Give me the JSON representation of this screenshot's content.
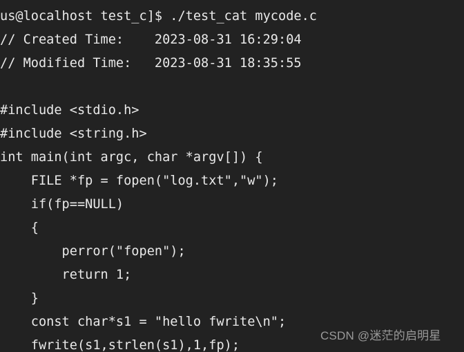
{
  "terminal": {
    "background_color": "#222222",
    "text_color": "#e9e9e9",
    "prompt_line": "us@localhost test_c]$ ./test_cat mycode.c",
    "lines": [
      {
        "text": "us@localhost test_c]$ ./test_cat mycode.c"
      },
      {
        "text": "// Created Time:    2023-08-31 16:29:04"
      },
      {
        "text": "// Modified Time:   2023-08-31 18:35:55"
      },
      {
        "text": ""
      },
      {
        "text": "#include <stdio.h>"
      },
      {
        "text": "#include <string.h>"
      },
      {
        "text": "int main(int argc, char *argv[]) {"
      },
      {
        "text": "    FILE *fp = fopen(\"log.txt\",\"w\");"
      },
      {
        "text": "    if(fp==NULL)"
      },
      {
        "text": "    {"
      },
      {
        "text": "        perror(\"fopen\");"
      },
      {
        "text": "        return 1;"
      },
      {
        "text": "    }"
      },
      {
        "text": "    const char*s1 = \"hello fwrite\\n\";"
      },
      {
        "text": "    fwrite(s1,strlen(s1),1,fp);"
      }
    ]
  },
  "watermark": {
    "text": "CSDN @迷茫的启明星",
    "color": "#9a9a9a"
  }
}
